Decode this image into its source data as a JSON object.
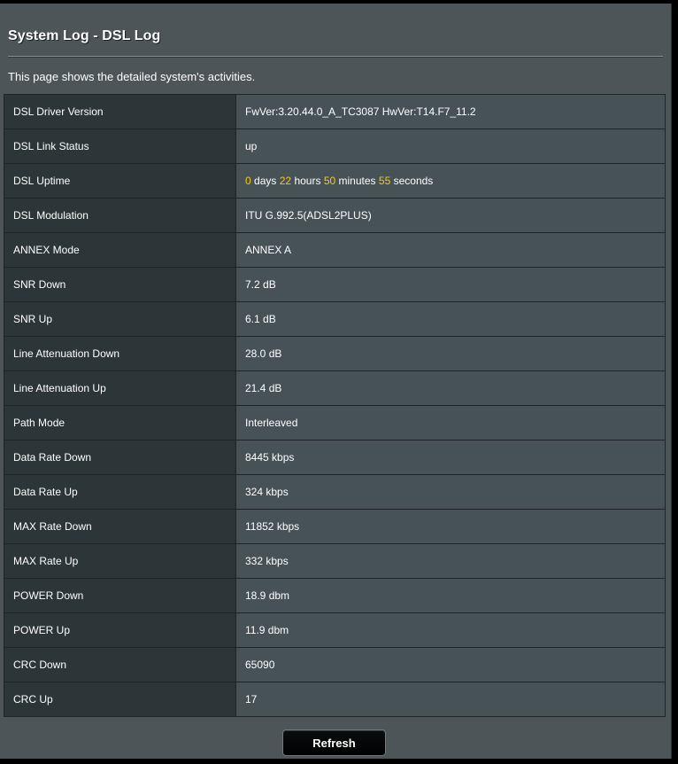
{
  "page": {
    "title": "System Log - DSL Log",
    "description": "This page shows the detailed system's activities."
  },
  "rows": [
    {
      "label": "DSL Driver Version",
      "value": "FwVer:3.20.44.0_A_TC3087 HwVer:T14.F7_11.2"
    },
    {
      "label": "DSL Link Status",
      "value": "up"
    },
    {
      "label": "DSL Uptime"
    },
    {
      "label": "DSL Modulation",
      "value": "ITU G.992.5(ADSL2PLUS)"
    },
    {
      "label": "ANNEX Mode",
      "value": "ANNEX A"
    },
    {
      "label": "SNR Down",
      "value": "7.2 dB"
    },
    {
      "label": "SNR Up",
      "value": "6.1 dB"
    },
    {
      "label": "Line Attenuation Down",
      "value": "28.0 dB"
    },
    {
      "label": "Line Attenuation Up",
      "value": "21.4 dB"
    },
    {
      "label": "Path Mode",
      "value": "Interleaved"
    },
    {
      "label": "Data Rate Down",
      "value": "8445 kbps"
    },
    {
      "label": "Data Rate Up",
      "value": "324 kbps"
    },
    {
      "label": "MAX Rate Down",
      "value": "11852 kbps"
    },
    {
      "label": "MAX Rate Up",
      "value": "332 kbps"
    },
    {
      "label": "POWER Down",
      "value": "18.9 dbm"
    },
    {
      "label": "POWER Up",
      "value": "11.9 dbm"
    },
    {
      "label": "CRC Down",
      "value": "65090"
    },
    {
      "label": "CRC Up",
      "value": "17"
    }
  ],
  "uptime": {
    "days": "0",
    "days_unit": "days",
    "hours": "22",
    "hours_unit": "hours",
    "minutes": "50",
    "minutes_unit": "minutes",
    "seconds": "55",
    "seconds_unit": "seconds"
  },
  "buttons": {
    "refresh_label": "Refresh"
  },
  "colors": {
    "panel_background": "#4d5558",
    "label_cell": "#2c3538",
    "value_cell": "#475256",
    "highlight": "#ffc907"
  }
}
